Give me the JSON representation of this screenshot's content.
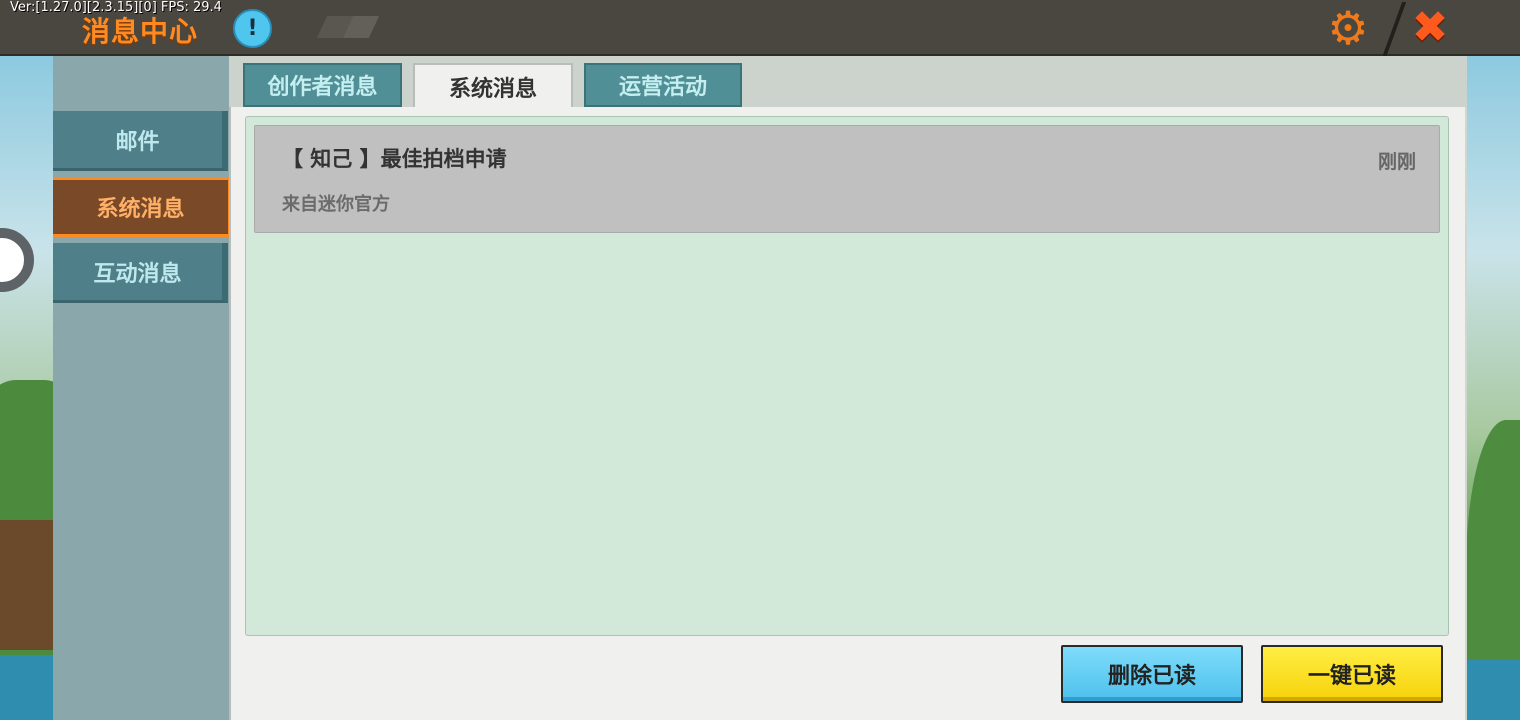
{
  "header": {
    "version_text": "Ver:[1.27.0][2.3.15][0] FPS: 29.4",
    "title": "消息中心",
    "info_icon_glyph": "!",
    "settings_icon": "gear-icon",
    "settings_glyph": "⚙",
    "close_icon": "close-icon",
    "close_glyph": "✖"
  },
  "sidebar": {
    "items": [
      {
        "label": "邮件",
        "active": false
      },
      {
        "label": "系统消息",
        "active": true
      },
      {
        "label": "互动消息",
        "active": false
      }
    ]
  },
  "tabs": [
    {
      "label": "创作者消息",
      "active": false
    },
    {
      "label": "系统消息",
      "active": true
    },
    {
      "label": "运营活动",
      "active": false
    }
  ],
  "messages": [
    {
      "title": "【 知己 】最佳拍档申请",
      "time": "刚刚",
      "from": "来自迷你官方"
    }
  ],
  "actions": {
    "delete_read": "删除已读",
    "mark_all_read": "一键已读"
  },
  "colors": {
    "accent_orange": "#ff8a22",
    "tab_teal": "#4f8f95",
    "button_blue": "#4cc0ec",
    "button_yellow": "#f6d20a"
  }
}
